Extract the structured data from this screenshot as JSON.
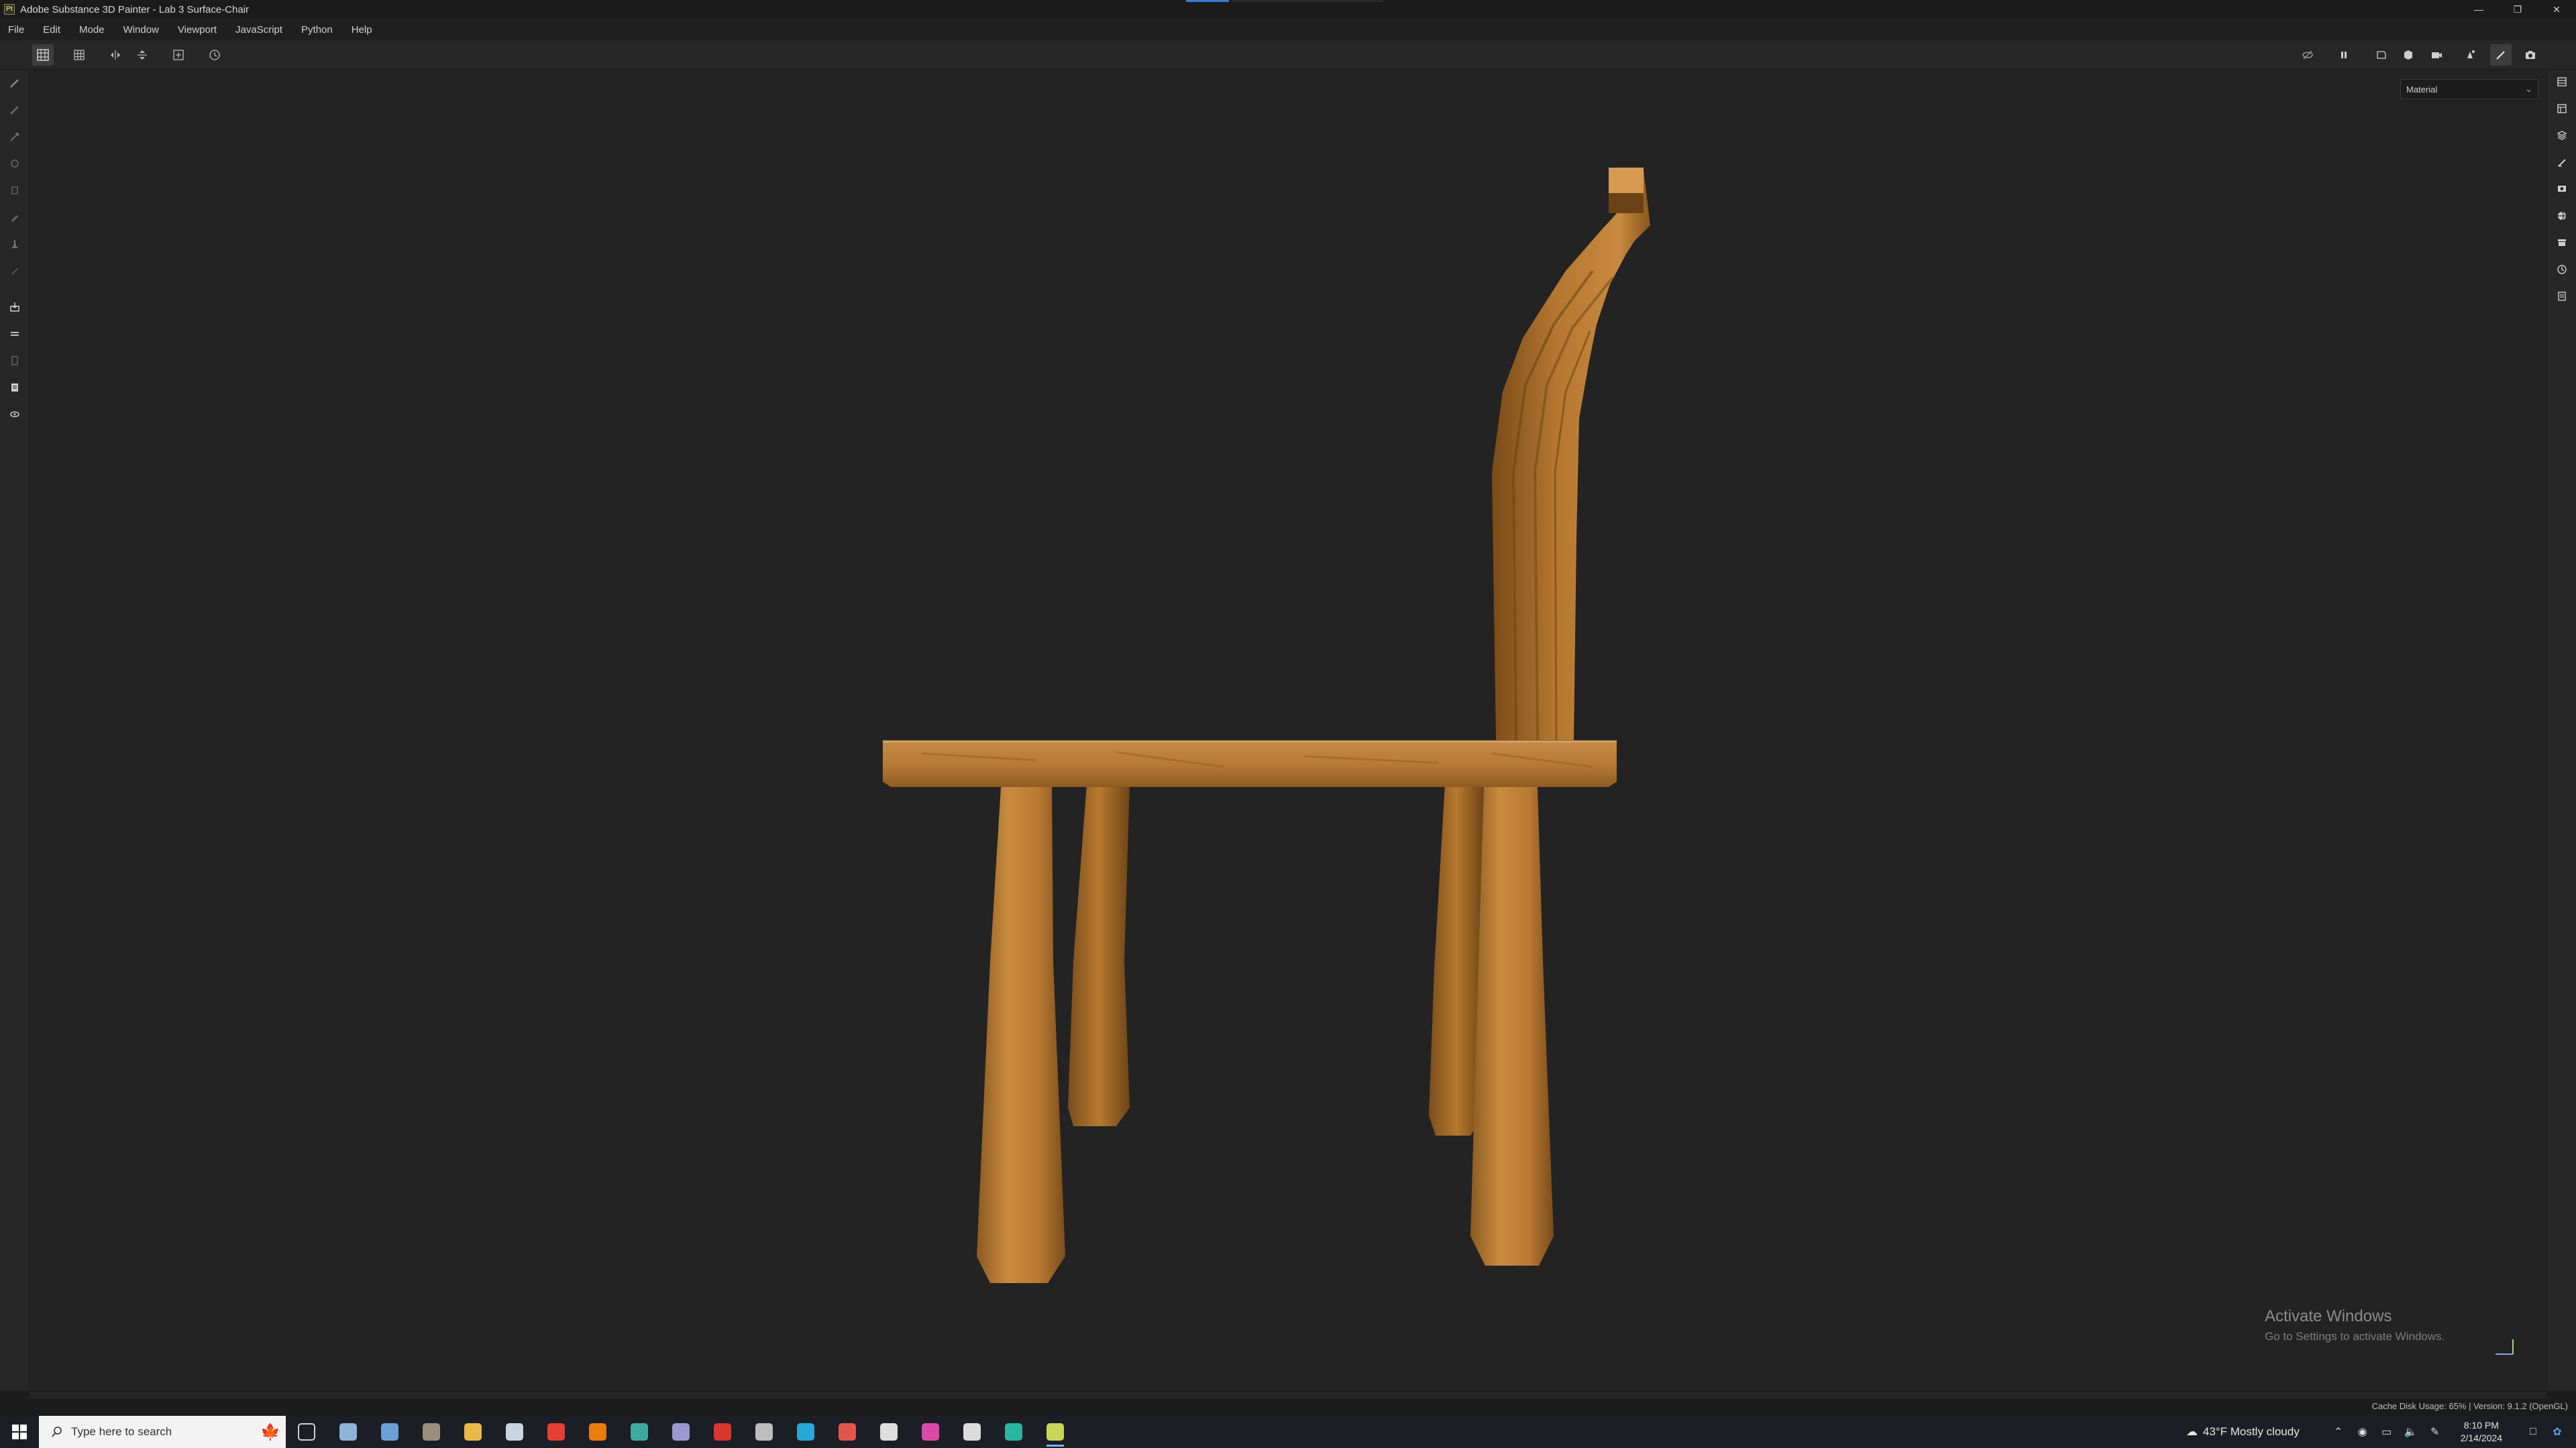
{
  "window": {
    "title": "Adobe Substance 3D Painter - Lab 3 Surface-Chair",
    "app_icon": "Pt",
    "controls": [
      "minimize-icon",
      "restore-icon",
      "close-icon"
    ]
  },
  "menu": {
    "items": [
      "File",
      "Edit",
      "Mode",
      "Window",
      "Viewport",
      "JavaScript",
      "Python",
      "Help"
    ]
  },
  "toolbar": {
    "left_icons": [
      "grid-symmetry-icon",
      "grid-icon",
      "mirror-x-icon",
      "mirror-y-icon",
      "add-frame-icon",
      "history-icon"
    ],
    "right_icons": [
      "visibility-off-icon",
      "pause-icon",
      "camera-2d-icon",
      "cube-icon",
      "camera-icon",
      "light-icon",
      "brush-active-icon",
      "screenshot-icon"
    ]
  },
  "viewport": {
    "channel_selector": "Material"
  },
  "left_tools": [
    "paint-brush-icon",
    "eraser-icon",
    "projection-icon",
    "geometry-mask-icon",
    "smudge-icon",
    "clone-icon",
    "polygon-fill-icon",
    "picker-icon",
    "stamp-icon",
    "bake-icon",
    "selection-icon",
    "transform-icon",
    "sample-icon",
    "layer-icon",
    "export-icon"
  ],
  "right_tools": [
    "layers-panel-icon",
    "properties-icon",
    "texture-set-icon",
    "brush-settings-icon",
    "display-icon",
    "environment-icon",
    "shelf-icon",
    "history-icon",
    "log-icon"
  ],
  "activation": {
    "title": "Activate Windows",
    "subtitle": "Go to Settings to activate Windows."
  },
  "status": {
    "cache": "Cache Disk Usage:  65% | Version: 9.1.2 (OpenGL)"
  },
  "taskbar": {
    "search_placeholder": "Type here to search",
    "weather": "43°F  Mostly cloudy",
    "time": "8:10 PM",
    "date": "2/14/2024",
    "apps": [
      {
        "name": "task-view-icon",
        "color": "#d0d0d0"
      },
      {
        "name": "app-gear-icon",
        "color": "#8fb4d9"
      },
      {
        "name": "calculator-icon",
        "color": "#6aa0d6"
      },
      {
        "name": "folder-stack-icon",
        "color": "#9a8f7a"
      },
      {
        "name": "file-explorer-icon",
        "color": "#e8b84a"
      },
      {
        "name": "steam-icon",
        "color": "#c7d5e0"
      },
      {
        "name": "chrome-icon",
        "color": "#e34133"
      },
      {
        "name": "blender-icon",
        "color": "#e87d0d"
      },
      {
        "name": "maya-icon",
        "color": "#3fa9a1"
      },
      {
        "name": "substance-designer-icon",
        "color": "#9a9ad0"
      },
      {
        "name": "acrobat-icon",
        "color": "#d9362e"
      },
      {
        "name": "zbrush-icon",
        "color": "#bdbdbd"
      },
      {
        "name": "app-blue-icon",
        "color": "#28a7d8"
      },
      {
        "name": "app-red-icon",
        "color": "#e0574b"
      },
      {
        "name": "obs-icon",
        "color": "#dedede"
      },
      {
        "name": "app-pink-icon",
        "color": "#d94aa8"
      },
      {
        "name": "xbox-icon",
        "color": "#dcdcdc"
      },
      {
        "name": "app-teal-icon",
        "color": "#2bb5a0"
      },
      {
        "name": "substance-painter-icon",
        "color": "#c8d45a"
      }
    ]
  }
}
